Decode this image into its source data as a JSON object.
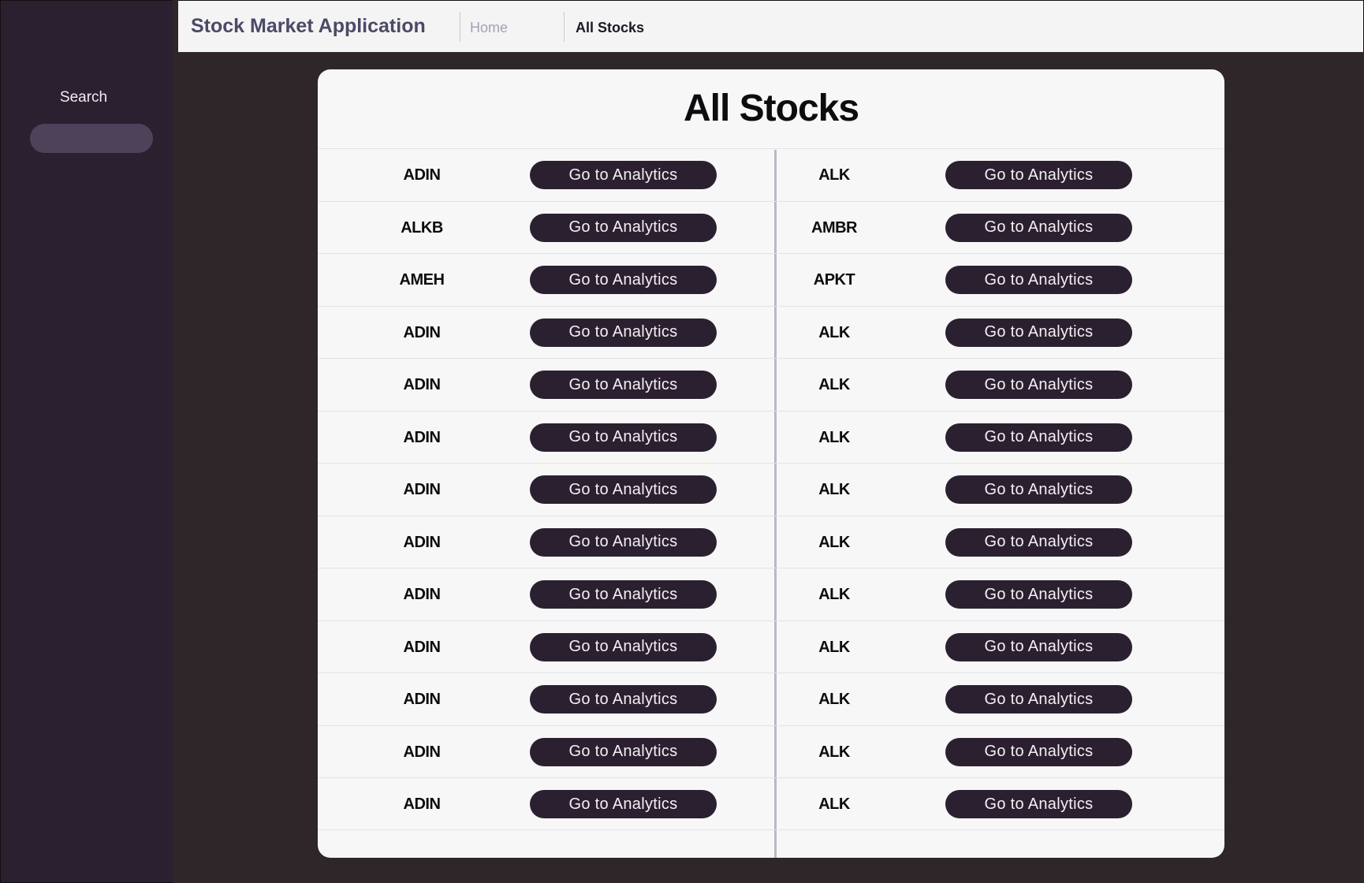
{
  "sidebar": {
    "search_label": "Search",
    "search_value": "",
    "search_placeholder": ""
  },
  "header": {
    "app_title": "Stock Market Application",
    "nav": [
      {
        "label": "Home",
        "active": false
      },
      {
        "label": "All Stocks",
        "active": true
      }
    ]
  },
  "main": {
    "title": "All Stocks",
    "button_label": "Go to Analytics",
    "rows": [
      {
        "left": "ADIN",
        "right": "ALK"
      },
      {
        "left": "ALKB",
        "right": "AMBR"
      },
      {
        "left": "AMEH",
        "right": "APKT"
      },
      {
        "left": "ADIN",
        "right": "ALK"
      },
      {
        "left": "ADIN",
        "right": "ALK"
      },
      {
        "left": "ADIN",
        "right": "ALK"
      },
      {
        "left": "ADIN",
        "right": "ALK"
      },
      {
        "left": "ADIN",
        "right": "ALK"
      },
      {
        "left": "ADIN",
        "right": "ALK"
      },
      {
        "left": "ADIN",
        "right": "ALK"
      },
      {
        "left": "ADIN",
        "right": "ALK"
      },
      {
        "left": "ADIN",
        "right": "ALK"
      },
      {
        "left": "ADIN",
        "right": "ALK"
      }
    ]
  },
  "colors": {
    "sidebar_bg": "#2b2030",
    "page_bg": "#2f2629",
    "button_bg": "#2b2030",
    "card_bg": "#f7f7f7",
    "title_color": "#4b4a66"
  }
}
